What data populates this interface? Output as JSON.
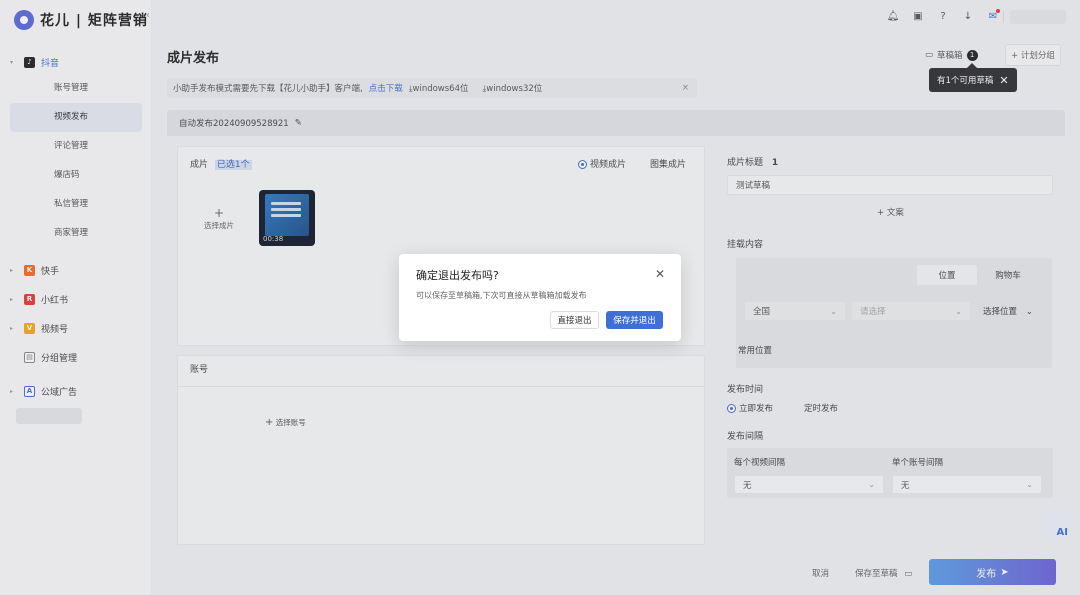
{
  "app": {
    "brand": "花儿 | 矩阵营销",
    "collapse_icon": "‹"
  },
  "sidebar": {
    "douyin": {
      "label": "抖音",
      "icon_color": "#222222"
    },
    "douyin_items": [
      "账号管理",
      "视频发布",
      "评论管理",
      "爆店码",
      "私信管理",
      "商家管理"
    ],
    "active_item": "视频发布",
    "kuaishou": {
      "label": "快手",
      "icon_color": "#f26b1d"
    },
    "xiaohongshu": {
      "label": "小红书",
      "icon_color": "#e53935"
    },
    "shipinhao": {
      "label": "视频号",
      "icon_color": "#f5a623"
    },
    "group": {
      "label": "分组管理"
    },
    "ads": {
      "label": "公域广告",
      "icon_color": "#3d6fd6"
    }
  },
  "topbar": {
    "icons": [
      "bell-icon",
      "gift-icon",
      "help-icon",
      "download-icon",
      "mail-icon"
    ]
  },
  "page": {
    "title": "成片发布",
    "draft_box": "草稿箱",
    "draft_count": "1",
    "plan_group": "+ 计划分组",
    "tooltip": "有1个可用草稿"
  },
  "notice": {
    "text": "小助手发布模式需要先下载【花儿小助手】客户端,",
    "link": "点击下载",
    "win64": "windows64位",
    "win32": "windows32位",
    "close": "×"
  },
  "task": {
    "name": "自动发布20240909528921"
  },
  "video": {
    "section_label": "成片",
    "selected": "已选1个",
    "option_video": "视频成片",
    "option_image": "图集成片",
    "select_label": "选择成片",
    "duration": "00:38"
  },
  "account": {
    "section_label": "账号",
    "select_label": "选择账号"
  },
  "right": {
    "title_label": "成片标题",
    "title_count": "1",
    "title_value": "测试草稿",
    "copy_btn": "+ 文案",
    "mount_label": "挂载内容",
    "tab_location": "位置",
    "tab_cart": "购物车",
    "region": "全国",
    "city": "请选择",
    "choose_location": "选择位置",
    "common_location": "常用位置",
    "time_label": "发布时间",
    "publish_now": "立即发布",
    "publish_timed": "定时发布",
    "interval_label": "发布间隔",
    "per_video": "每个视频间隔",
    "per_account": "单个账号间隔",
    "none1": "无",
    "none2": "无"
  },
  "modal": {
    "title": "确定退出发布吗?",
    "desc": "可以保存至草稿箱,下次可直接从草稿箱加载发布",
    "exit": "直接退出",
    "save_exit": "保存并退出"
  },
  "footer": {
    "cancel": "取消",
    "save_draft": "保存至草稿",
    "publish": "发布"
  },
  "ai": {
    "label": "AI"
  }
}
